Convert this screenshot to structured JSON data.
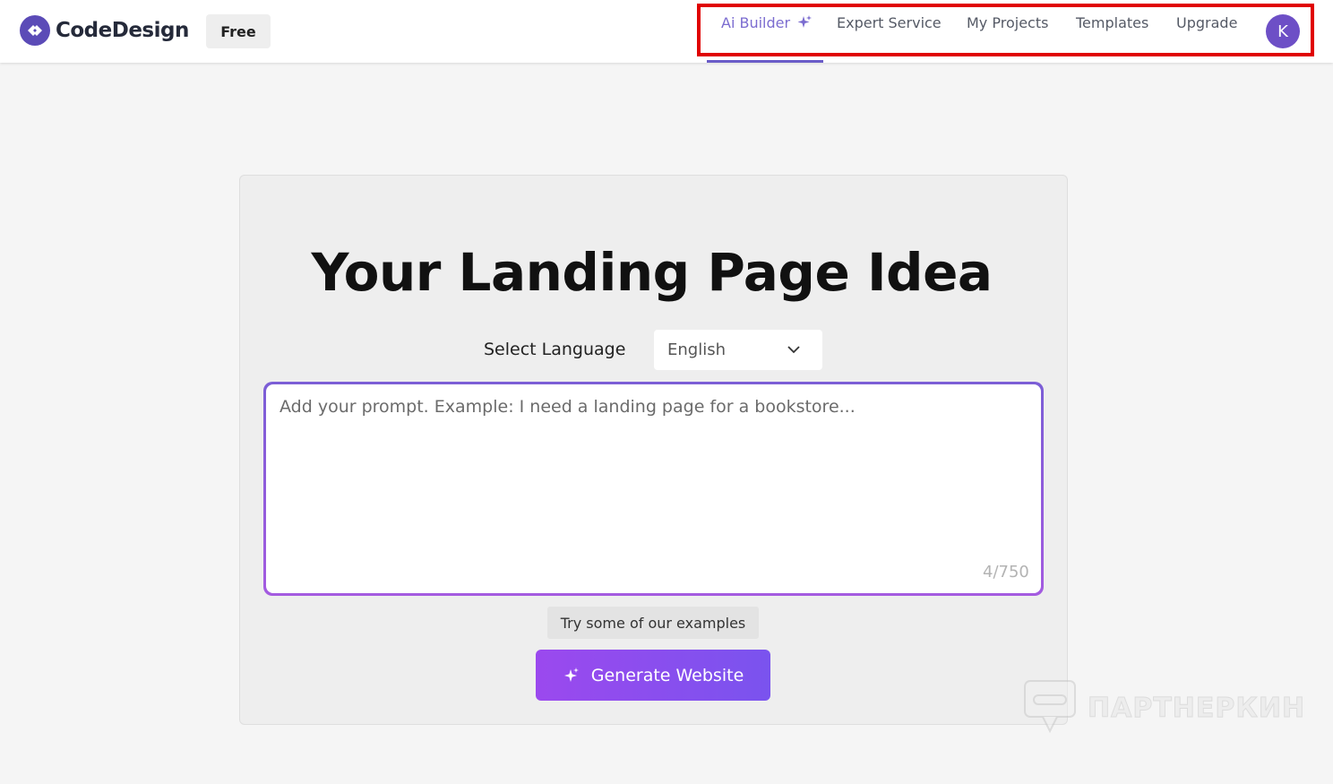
{
  "header": {
    "brand": "CodeDesign",
    "plan_badge": "Free",
    "nav": [
      {
        "label": "Ai Builder",
        "active": true,
        "icon": "sparkle-icon"
      },
      {
        "label": "Expert Service",
        "active": false
      },
      {
        "label": "My Projects",
        "active": false
      },
      {
        "label": "Templates",
        "active": false
      },
      {
        "label": "Upgrade",
        "active": false
      }
    ],
    "avatar_initial": "K",
    "accent_color": "#7b6cd0",
    "highlight_box_color": "#e00000"
  },
  "main": {
    "title": "Your Landing Page Idea",
    "language_label": "Select Language",
    "language_value": "English",
    "prompt": {
      "placeholder": "Add your prompt. Example: I need a landing page for a bookstore...",
      "counter": "4/750"
    },
    "examples_button": "Try some of our examples",
    "generate_button": "Generate Website",
    "button_color": "#8b4ff0"
  },
  "watermark": {
    "text": "ПАРТНЕРКИН"
  }
}
